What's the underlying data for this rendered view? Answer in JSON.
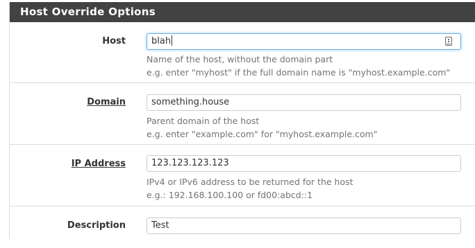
{
  "panel": {
    "title": "Host Override Options"
  },
  "fields": {
    "host": {
      "label": "Host",
      "value": "blah",
      "help_line1": "Name of the host, without the domain part",
      "help_line2": "e.g. enter \"myhost\" if the full domain name is \"myhost.example.com\""
    },
    "domain": {
      "label": "Domain",
      "value": "something.house",
      "help_line1": "Parent domain of the host",
      "help_line2": "e.g. enter \"example.com\" for \"myhost.example.com\""
    },
    "ip": {
      "label": "IP Address",
      "value": "123.123.123.123",
      "help_line1": "IPv4 or IPv6 address to be returned for the host",
      "help_line2": "e.g.: 192.168.100.100 or fd00:abcd::1"
    },
    "description": {
      "label": "Description",
      "value": "Test"
    }
  },
  "icons": {
    "host_field_icon": "keyboard-icon"
  },
  "colors": {
    "heading_bg": "#424242",
    "focus_border": "#66afe9",
    "help_text": "#737373"
  }
}
